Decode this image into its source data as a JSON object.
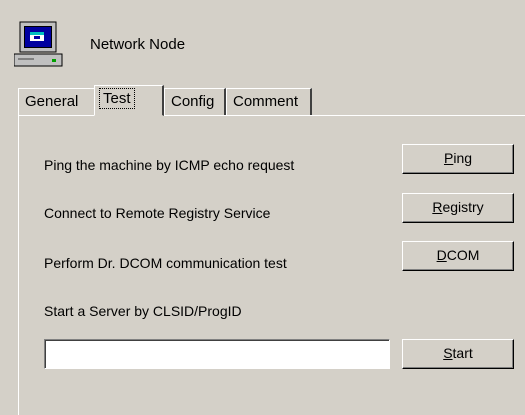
{
  "header": {
    "title": "Network Node",
    "icon": "computer-icon"
  },
  "tabs": [
    {
      "label": "General",
      "selected": false
    },
    {
      "label": "Test",
      "selected": true
    },
    {
      "label": "Config",
      "selected": false
    },
    {
      "label": "Comment",
      "selected": false
    }
  ],
  "tests": {
    "ping": {
      "label": "Ping the machine by ICMP echo request",
      "button_first": "P",
      "button_rest": "ing"
    },
    "registry": {
      "label": "Connect to Remote Registry Service",
      "button_first": "R",
      "button_rest": "egistry"
    },
    "dcom": {
      "label": "Perform Dr. DCOM communication test",
      "button_first": "D",
      "button_rest": "COM"
    },
    "server": {
      "label": "Start a Server by CLSID/ProgID",
      "input_value": "",
      "button_first": "S",
      "button_rest": "tart"
    }
  },
  "colors": {
    "face": "#d4d0c8",
    "icon_blue": "#0000a0"
  }
}
